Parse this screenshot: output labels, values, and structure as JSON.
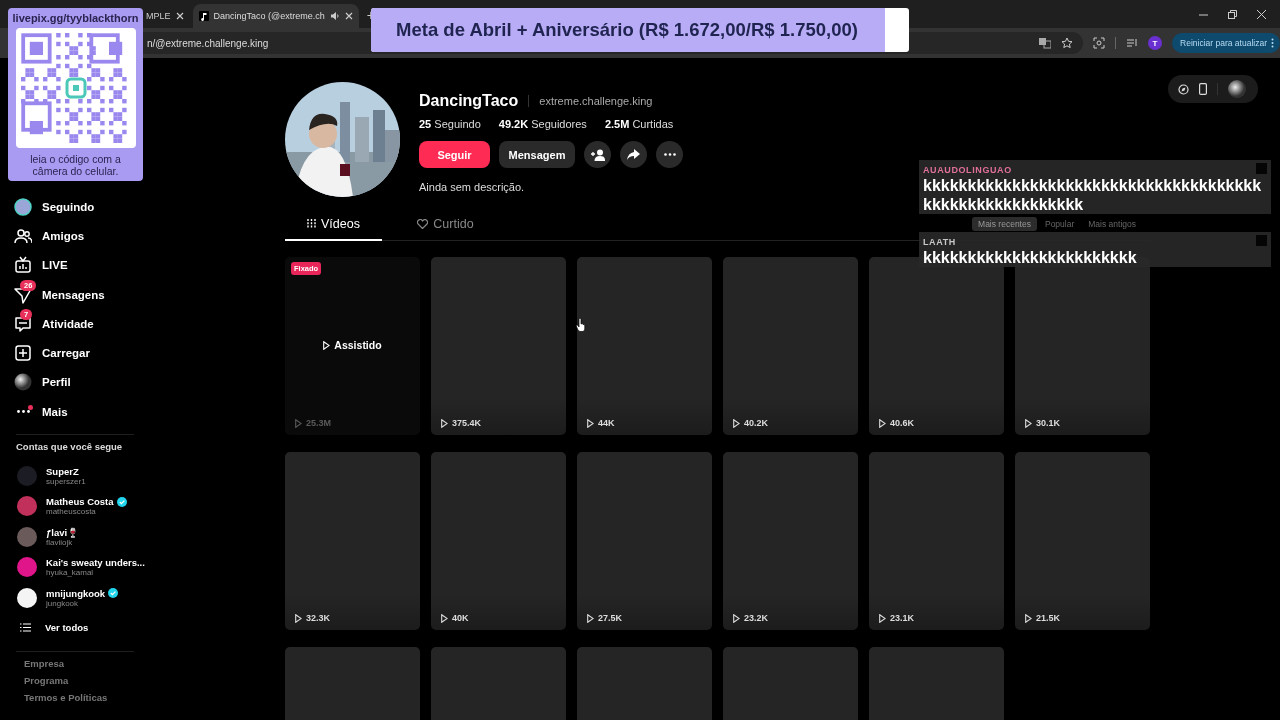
{
  "browser": {
    "tabs": [
      {
        "title": "MPLE",
        "selected": false,
        "audio": false
      },
      {
        "title": "DancingTaco (@extreme.ch",
        "selected": true,
        "audio": true
      }
    ],
    "new_tab": "+",
    "address": "n/@extreme.challenge.king",
    "profile_initial": "T",
    "update_button": "Reiniciar para atualizar"
  },
  "sidebar": {
    "nav": [
      {
        "label": "Seguindo"
      },
      {
        "label": "Amigos"
      },
      {
        "label": "LIVE"
      },
      {
        "label": "Mensagens",
        "badge": "26"
      },
      {
        "label": "Atividade",
        "badge": "7"
      },
      {
        "label": "Carregar"
      },
      {
        "label": "Perfil"
      },
      {
        "label": "Mais",
        "dot": true
      }
    ],
    "following_title": "Contas que você segue",
    "accounts": [
      {
        "name": "SuperZ",
        "handle": "superszer1",
        "verified": false,
        "color": "#1c1c24"
      },
      {
        "name": "Matheus Costa",
        "handle": "matheuscosta",
        "verified": true,
        "color": "#c0305a"
      },
      {
        "name": "ƒlavi🍷",
        "handle": "flaviiojk",
        "verified": false,
        "color": "#6a5a5a"
      },
      {
        "name": "Kai's sweaty unders...",
        "handle": "hyuka_kamal",
        "verified": false,
        "color": "#e0158a"
      },
      {
        "name": "mnijungkook",
        "handle": "jungkook",
        "verified": true,
        "color": "#f4f4f4"
      }
    ],
    "see_all": "Ver todos",
    "footer": [
      "Empresa",
      "Programa",
      "Termos e Políticas"
    ]
  },
  "profile": {
    "name": "DancingTaco",
    "username": "extreme.challenge.king",
    "stats": [
      "**25** Seguindo",
      "**49.2K** Seguidores",
      "**2.5M** Curtidas"
    ],
    "follow_button": "Seguir",
    "message_button": "Mensagem",
    "bio": "Ainda sem descrição.",
    "tabs": [
      {
        "label": "Vídeos",
        "selected": true
      },
      {
        "label": "Curtido",
        "selected": false
      }
    ],
    "sort_tabs": [
      {
        "label": "Mais recentes",
        "selected": true
      },
      {
        "label": "Popular",
        "selected": false
      },
      {
        "label": "Mais antigos",
        "selected": false
      }
    ]
  },
  "videos": [
    {
      "kind": "pinned",
      "badge": "Fixado",
      "status": "Assistido",
      "views": "25.3M"
    },
    {
      "kind": "video",
      "views": "375.4K"
    },
    {
      "kind": "video",
      "views": "44K"
    },
    {
      "kind": "video",
      "views": "40.2K"
    },
    {
      "kind": "video",
      "views": "40.6K"
    },
    {
      "kind": "video",
      "views": "30.1K"
    },
    {
      "kind": "video",
      "views": "32.3K"
    },
    {
      "kind": "video",
      "views": "40K"
    },
    {
      "kind": "video",
      "views": "27.5K"
    },
    {
      "kind": "video",
      "views": "23.2K"
    },
    {
      "kind": "video",
      "views": "23.1K"
    },
    {
      "kind": "video",
      "views": "21.5K"
    },
    {
      "kind": "video"
    },
    {
      "kind": "video"
    },
    {
      "kind": "video"
    },
    {
      "kind": "video"
    },
    {
      "kind": "video"
    }
  ],
  "overlay": {
    "qr": {
      "url": "livepix.gg/tyyblackthorn",
      "caption": "leia o código com a câmera do celular."
    },
    "goal": {
      "text": "Meta de Abril + Aniversário (R$ 1.672,00/R$ 1.750,00)",
      "level": 0.955
    },
    "chat": [
      {
        "user": "AUAUDOLINGUAO",
        "color": "#e0709a",
        "message": "kkkkkkkkkkkkkkkkkkkkkkkkkkkkkkkkkkkkkkkkkkkkkkkkkkkkkkkk"
      },
      {
        "user": "LAATH",
        "color": "#c8c8c8",
        "message": "kkkkkkkkkkkkkkkkkkkkkkkk"
      }
    ]
  }
}
